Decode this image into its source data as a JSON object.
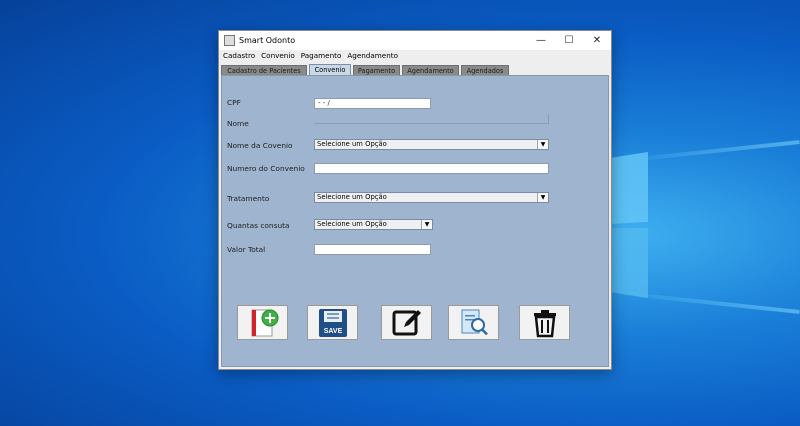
{
  "window": {
    "title": "Smart Odonto",
    "minimize": "—",
    "maximize": "☐",
    "close": "✕"
  },
  "menu": [
    "Cadastro",
    "Convenio",
    "Pagamento",
    "Agendamento"
  ],
  "tabs": [
    {
      "label": "Cadastro de Pacientes",
      "active": false
    },
    {
      "label": "Convenio",
      "active": true
    },
    {
      "label": "Pagamento",
      "active": false
    },
    {
      "label": "Agendamento",
      "active": false
    },
    {
      "label": "Agendados",
      "active": false
    }
  ],
  "form": {
    "cpf": {
      "label": "CPF",
      "value": "  -  -  /"
    },
    "nome": {
      "label": "Nome",
      "value": ""
    },
    "nome_convenio": {
      "label": "Nome da Covenio",
      "selected": "Selecione um Opção"
    },
    "numero_convenio": {
      "label": "Numero do Convenio",
      "value": ""
    },
    "tratamento": {
      "label": "Tratamento",
      "selected": "Selecione um Opção"
    },
    "quantas_consulta": {
      "label": "Quantas consuta",
      "selected": "Selecione um Opção"
    },
    "valor_total": {
      "label": "Valor Total",
      "value": ""
    }
  },
  "buttons": {
    "add_icon": "add-record-icon",
    "save_icon": "save-icon",
    "save_text": "SAVE",
    "edit_icon": "edit-icon",
    "search_icon": "search-document-icon",
    "delete_icon": "trash-icon"
  },
  "colors": {
    "panel": "#9fb5cf",
    "active_tab": "#c9d7e6",
    "inactive_tab": "#8a8a8a"
  }
}
